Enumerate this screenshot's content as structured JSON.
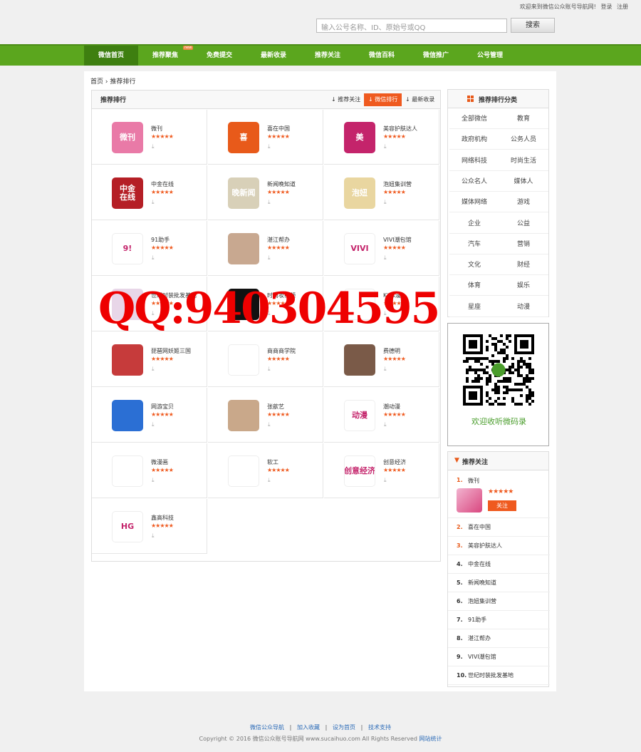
{
  "header": {
    "welcome": "欢迎来到微信公众账号导航网!",
    "login": "登录",
    "register": "注册",
    "search_placeholder": "输入公号名称、ID、原始号或QQ",
    "search_button": "搜索"
  },
  "nav": {
    "items": [
      "微信首页",
      "推荐聚焦",
      "免费提交",
      "最新收录",
      "推荐关注",
      "微信百科",
      "微信推广",
      "公号管理"
    ],
    "hot_badge": "new"
  },
  "breadcrumb": {
    "home": "首页",
    "sep": "›",
    "current": "推荐排行"
  },
  "panel": {
    "title": "推荐排行",
    "tabs": [
      "推荐关注",
      "微信排行",
      "最新收录"
    ]
  },
  "accounts": [
    {
      "name": "微刊",
      "stars": "★★★★★",
      "color": "#e97aa7",
      "label": "微刊"
    },
    {
      "name": "喜在中国",
      "stars": "★★★★★",
      "color": "#e85a1a",
      "label": "喜"
    },
    {
      "name": "美容护肤达人",
      "stars": "★★★★★",
      "color": "#c4246b",
      "label": "美"
    },
    {
      "name": "中金在线",
      "stars": "★★★★★",
      "color": "#b51f26",
      "label": "中金\n在线"
    },
    {
      "name": "新闻晚知道",
      "stars": "★★★★★",
      "color": "#d8d0b8",
      "label": "晚新闻"
    },
    {
      "name": "泡妞集训营",
      "stars": "★★★★★",
      "color": "#e9d6a0",
      "label": "泡妞"
    },
    {
      "name": "91助手",
      "stars": "★★★★★",
      "color": "#fff",
      "label": "9!"
    },
    {
      "name": "湛江帮办",
      "stars": "★★★★★",
      "color": "#c8a890",
      "label": ""
    },
    {
      "name": "VIVI潮包馆",
      "stars": "★★★★★",
      "color": "#fff",
      "label": "VIVI"
    },
    {
      "name": "世纪时装批发基地",
      "stars": "★★★★★",
      "color": "#e8d6e8",
      "label": ""
    },
    {
      "name": "时尚妆视频",
      "stars": "★★★★★",
      "color": "#111",
      "label": ""
    },
    {
      "name": "Kids漫",
      "stars": "★★★★★",
      "color": "#fff",
      "label": ""
    },
    {
      "name": "琵琶网妖姬三国",
      "stars": "★★★★★",
      "color": "#c63b3b",
      "label": ""
    },
    {
      "name": "商商商学院",
      "stars": "★★★★★",
      "color": "#fff",
      "label": ""
    },
    {
      "name": "费德明",
      "stars": "★★★★★",
      "color": "#7a5a48",
      "label": ""
    },
    {
      "name": "网游宝贝",
      "stars": "★★★★★",
      "color": "#2b6fd4",
      "label": ""
    },
    {
      "name": "张歆艺",
      "stars": "★★★★★",
      "color": "#c9a88a",
      "label": ""
    },
    {
      "name": "潮动漫",
      "stars": "★★★★★",
      "color": "#fff",
      "label": "动漫"
    },
    {
      "name": "微漫画",
      "stars": "★★★★★",
      "color": "#fff",
      "label": ""
    },
    {
      "name": "软工",
      "stars": "★★★★★",
      "color": "#fff",
      "label": ""
    },
    {
      "name": "创意经济",
      "stars": "★★★★★",
      "color": "#fff",
      "label": "创意经济"
    },
    {
      "name": "鑫高科技",
      "stars": "★★★★★",
      "color": "#fff",
      "label": "HG"
    }
  ],
  "categories": {
    "title": "推荐排行分类",
    "items": [
      "全部微信",
      "教育",
      "政府机构",
      "公务人员",
      "网络科技",
      "时尚生活",
      "公众名人",
      "媒体人",
      "媒体网络",
      "游戏",
      "企业",
      "公益",
      "汽车",
      "营销",
      "文化",
      "财经",
      "体育",
      "娱乐",
      "星座",
      "动漫"
    ]
  },
  "qr": {
    "caption": "欢迎收听微码录"
  },
  "recommend": {
    "title": "推荐关注",
    "top": {
      "rank": "1.",
      "name": "微刊",
      "stars": "★★★★★",
      "follow": "关注"
    },
    "list": [
      {
        "rank": "2.",
        "name": "喜在中国"
      },
      {
        "rank": "3.",
        "name": "美容护肤达人"
      },
      {
        "rank": "4.",
        "name": "中金在线"
      },
      {
        "rank": "5.",
        "name": "新闻晚知道"
      },
      {
        "rank": "6.",
        "name": "泡妞集训营"
      },
      {
        "rank": "7.",
        "name": "91助手"
      },
      {
        "rank": "8.",
        "name": "湛江帮办"
      },
      {
        "rank": "9.",
        "name": "VIVI潮包馆"
      },
      {
        "rank": "10.",
        "name": "世纪时装批发基地"
      }
    ]
  },
  "watermark": "QQ:940304595",
  "footer": {
    "links": [
      "微信公众导航",
      "加入收藏",
      "设为首页",
      "技术支持"
    ],
    "sep": "|",
    "copyright": "Copyright © 2016 微信公众账号导航网 www.sucaihuo.com All Rights Reserved",
    "stats": "网站统计"
  }
}
